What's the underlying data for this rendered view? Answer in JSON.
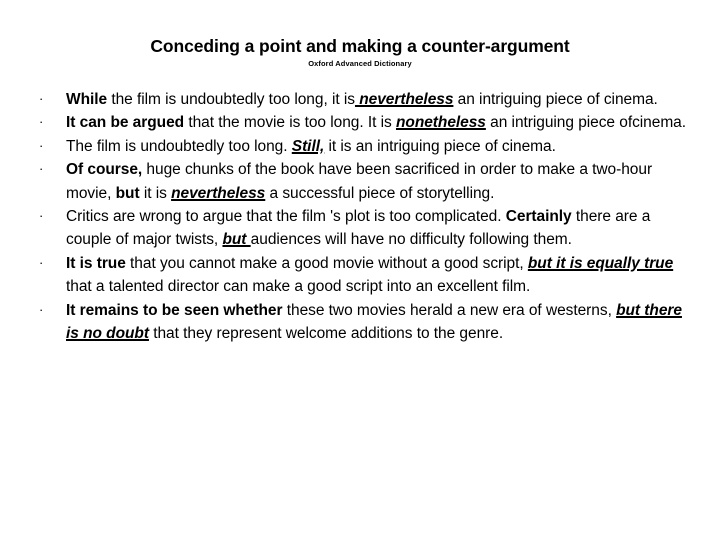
{
  "slide": {
    "title_runs": [
      {
        "text": "Conceding a point",
        "style": "strong"
      },
      {
        "text": " and ",
        "style": "mid"
      },
      {
        "text": "making a counter-argument",
        "style": "strong"
      }
    ],
    "title_plain": "Conceding a point and making a counter-argument",
    "subtitle": "Oxford Advanced Dictionary",
    "bullet_marker": "·",
    "bullets": [
      {
        "plain": "While the film is undoubtedly too long, it is nevertheless an intriguing piece of cinema.",
        "runs": [
          {
            "text": "While",
            "style": "b"
          },
          {
            "text": " the film is undoubtedly too long, it is",
            "style": "n"
          },
          {
            "text": " nevertheless",
            "style": "biu"
          },
          {
            "text": " an intriguing piece of cinema.",
            "style": "n"
          }
        ]
      },
      {
        "plain": "It can be argued that the movie is too long. It is nonetheless an intriguing piece ofcinema.",
        "runs": [
          {
            "text": "It can be argued",
            "style": "b"
          },
          {
            "text": " that the movie is too long. It is ",
            "style": "n"
          },
          {
            "text": "nonetheless",
            "style": "biu"
          },
          {
            "text": " an intriguing piece ofcinema.",
            "style": "n"
          }
        ]
      },
      {
        "plain": "The film is undoubtedly too long. Still, it is an intriguing piece of cinema.",
        "runs": [
          {
            "text": "The film is undoubtedly too long. ",
            "style": "n"
          },
          {
            "text": "Still,",
            "style": "biu"
          },
          {
            "text": " it is an intriguing piece of cinema.",
            "style": "n"
          }
        ]
      },
      {
        "plain": "Of course, huge chunks of the book have been sacrificed in order to make a two-hour movie, but it is nevertheless a successful piece of storytelling.",
        "runs": [
          {
            "text": "Of course,",
            "style": "b"
          },
          {
            "text": " huge chunks of the book have been sacrificed in order to make a two-hour movie, ",
            "style": "n"
          },
          {
            "text": "but",
            "style": "b"
          },
          {
            "text": " it is ",
            "style": "n"
          },
          {
            "text": "nevertheless",
            "style": "biu"
          },
          {
            "text": " a successful piece of storytelling.",
            "style": "n"
          }
        ]
      },
      {
        "plain": "Critics are wrong to argue that the film 's plot is too complicated. Certainly there are a couple of major twists, but audiences will have no difficulty following them.",
        "runs": [
          {
            "text": "Critics are wrong to argue that the film 's plot is too complicated. ",
            "style": "n"
          },
          {
            "text": "Certainly",
            "style": "b"
          },
          {
            "text": " there are a couple of major twists, ",
            "style": "n"
          },
          {
            "text": "but ",
            "style": "biu"
          },
          {
            "text": "audiences will have no difficulty following them.",
            "style": "n"
          }
        ]
      },
      {
        "plain": "It is true that you cannot make a good movie without a good script, but it is equally true that a talented director can make a good script into an excellent film.",
        "runs": [
          {
            "text": "It is true",
            "style": "b"
          },
          {
            "text": " that you cannot make a good movie without a good script, ",
            "style": "n"
          },
          {
            "text": "but it is equally true",
            "style": "biu"
          },
          {
            "text": " that a talented director can make a good script into an excellent film.",
            "style": "n"
          }
        ]
      },
      {
        "plain": "It remains to be seen whether these two movies herald a new era of westerns, but there is no doubt that they represent welcome additions to the genre.",
        "runs": [
          {
            "text": "It remains to be seen whether",
            "style": "b"
          },
          {
            "text": " these two movies herald a new era of westerns, ",
            "style": "n"
          },
          {
            "text": "but there is no doubt",
            "style": "biu"
          },
          {
            "text": " that they represent welcome additions to the genre.",
            "style": "n"
          }
        ]
      }
    ]
  },
  "colors": {
    "background": "#ffffff",
    "text": "#000000"
  }
}
